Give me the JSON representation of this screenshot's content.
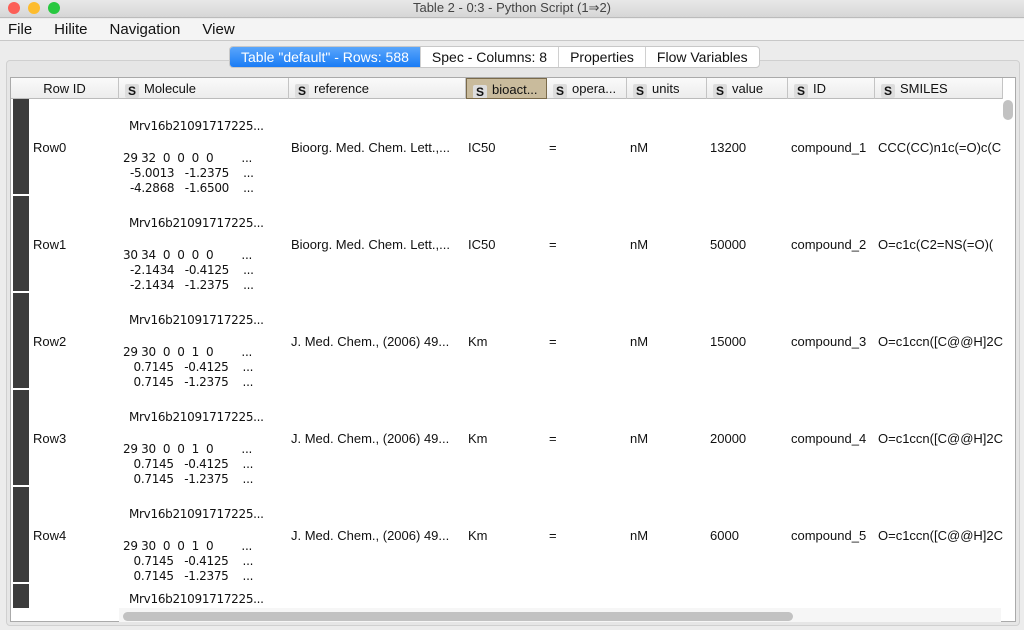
{
  "window": {
    "title": "Table 2 - 0:3 - Python Script (1⇒2)"
  },
  "menu": [
    "File",
    "Hilite",
    "Navigation",
    "View"
  ],
  "tabs": [
    "Table \"default\" - Rows: 588",
    "Spec - Columns: 8",
    "Properties",
    "Flow Variables"
  ],
  "columns": [
    {
      "label": "Row ID",
      "type": ""
    },
    {
      "label": "Molecule",
      "type": "S"
    },
    {
      "label": "reference",
      "type": "S"
    },
    {
      "label": "bioact...",
      "type": "S"
    },
    {
      "label": "opera...",
      "type": "S"
    },
    {
      "label": "units",
      "type": "S"
    },
    {
      "label": "value",
      "type": "S"
    },
    {
      "label": "ID",
      "type": "S"
    },
    {
      "label": "SMILES",
      "type": "S"
    }
  ],
  "rows": [
    {
      "id": "Row0",
      "mol": [
        "Mrv16b21091717225...",
        "29 32  0  0  0  0        ...",
        "  -5.0013   -1.2375    ...",
        "  -4.2868   -1.6500    ..."
      ],
      "reference": "Bioorg. Med. Chem. Lett.,...",
      "bioact": "IC50",
      "op": "=",
      "units": "nM",
      "value": "13200",
      "cid": "compound_1",
      "smiles": "CCC(CC)n1c(=O)c(C"
    },
    {
      "id": "Row1",
      "mol": [
        "Mrv16b21091717225...",
        "30 34  0  0  0  0        ...",
        "  -2.1434   -0.4125    ...",
        "  -2.1434   -1.2375    ..."
      ],
      "reference": "Bioorg. Med. Chem. Lett.,...",
      "bioact": "IC50",
      "op": "=",
      "units": "nM",
      "value": "50000",
      "cid": "compound_2",
      "smiles": "O=c1c(C2=NS(=O)("
    },
    {
      "id": "Row2",
      "mol": [
        "Mrv16b21091717225...",
        "29 30  0  0  1  0        ...",
        "   0.7145   -0.4125    ...",
        "   0.7145   -1.2375    ..."
      ],
      "reference": "J. Med. Chem., (2006) 49...",
      "bioact": "Km",
      "op": "=",
      "units": "nM",
      "value": "15000",
      "cid": "compound_3",
      "smiles": "O=c1ccn([C@@H]2C"
    },
    {
      "id": "Row3",
      "mol": [
        "Mrv16b21091717225...",
        "29 30  0  0  1  0        ...",
        "   0.7145   -0.4125    ...",
        "   0.7145   -1.2375    ..."
      ],
      "reference": "J. Med. Chem., (2006) 49...",
      "bioact": "Km",
      "op": "=",
      "units": "nM",
      "value": "20000",
      "cid": "compound_4",
      "smiles": "O=c1ccn([C@@H]2C"
    },
    {
      "id": "Row4",
      "mol": [
        "Mrv16b21091717225...",
        "29 30  0  0  1  0        ...",
        "   0.7145   -0.4125    ...",
        "   0.7145   -1.2375    ..."
      ],
      "reference": "J. Med. Chem., (2006) 49...",
      "bioact": "Km",
      "op": "=",
      "units": "nM",
      "value": "6000",
      "cid": "compound_5",
      "smiles": "O=c1ccn([C@@H]2C"
    },
    {
      "id": "",
      "mol": [
        "Mrv16b21091717225..."
      ],
      "reference": "",
      "bioact": "",
      "op": "",
      "units": "",
      "value": "",
      "cid": "",
      "smiles": ""
    }
  ]
}
